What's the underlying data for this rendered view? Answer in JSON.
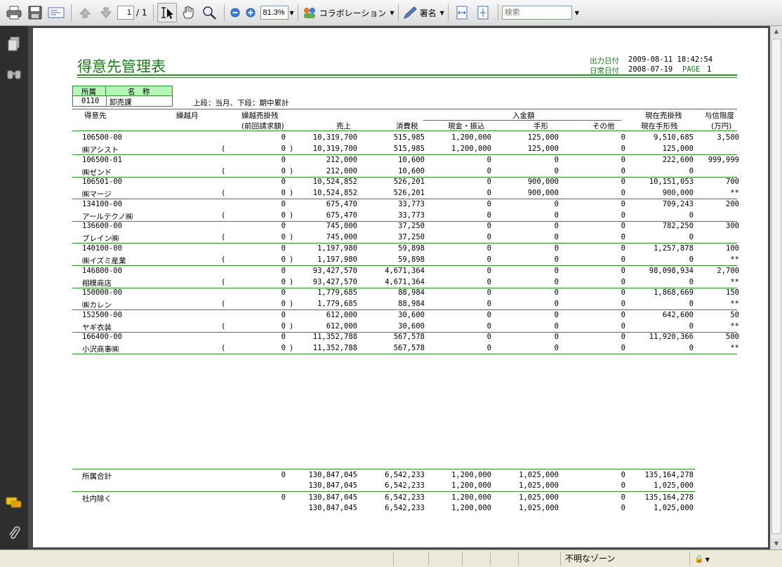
{
  "toolbar": {
    "page_current": "1",
    "page_total": "/ 1",
    "zoom": "81.3%",
    "collab_label": "コラボレーション",
    "sign_label": "署名",
    "search_placeholder": "検索"
  },
  "report": {
    "title": "得意先管理表",
    "output_date_label": "出力日付",
    "output_date": "2009-08-11 18:42:54",
    "daily_date_label": "日常日付",
    "daily_date": "2008-07-19",
    "page_label": "PAGE",
    "page_num": "1",
    "dept_header": "所属",
    "name_header": "名　称",
    "dept_code": "0110",
    "dept_name": "卸売課",
    "legend": "上段：当月、下段：期中累計",
    "headers": {
      "customer": "得意先",
      "carry_month": "繰越月",
      "carry_balance": "繰越売掛残",
      "prev_billing": "(前回請求額)",
      "sales": "売上",
      "tax": "消費税",
      "receipts": "入金額",
      "cash": "現金・振込",
      "bill": "手形",
      "other": "その他",
      "current_balance": "現在売掛残",
      "current_bill": "現在手形残",
      "credit_limit": "与信限度",
      "credit_unit": "(万円)"
    },
    "rows": [
      {
        "code": "106500-00",
        "name": "㈱アシスト",
        "carry1": "0",
        "carry2": "0",
        "sales1": "10,319,700",
        "sales2": "10,319,700",
        "tax1": "515,985",
        "tax2": "515,985",
        "cash1": "1,200,000",
        "cash2": "1,200,000",
        "bill1": "125,000",
        "bill2": "125,000",
        "other1": "0",
        "other2": "0",
        "bal1": "9,510,685",
        "bal2": "125,000",
        "limit1": "3,500",
        "limit2": ""
      },
      {
        "code": "106500-01",
        "name": "㈱ゼンド",
        "carry1": "0",
        "carry2": "0",
        "sales1": "212,000",
        "sales2": "212,000",
        "tax1": "10,600",
        "tax2": "10,600",
        "cash1": "0",
        "cash2": "0",
        "bill1": "0",
        "bill2": "0",
        "other1": "0",
        "other2": "0",
        "bal1": "222,600",
        "bal2": "0",
        "limit1": "999,999",
        "limit2": ""
      },
      {
        "code": "106501-00",
        "name": "㈱マージ",
        "carry1": "0",
        "carry2": "0",
        "sales1": "10,524,852",
        "sales2": "10,524,852",
        "tax1": "526,201",
        "tax2": "526,201",
        "cash1": "0",
        "cash2": "0",
        "bill1": "900,000",
        "bill2": "900,000",
        "other1": "0",
        "other2": "0",
        "bal1": "10,151,053",
        "bal2": "900,000",
        "limit1": "700",
        "limit2": "**"
      },
      {
        "code": "134100-00",
        "name": "アールテクノ㈱",
        "carry1": "0",
        "carry2": "0",
        "sales1": "675,470",
        "sales2": "675,470",
        "tax1": "33,773",
        "tax2": "33,773",
        "cash1": "0",
        "cash2": "0",
        "bill1": "0",
        "bill2": "0",
        "other1": "0",
        "other2": "0",
        "bal1": "709,243",
        "bal2": "0",
        "limit1": "200",
        "limit2": ""
      },
      {
        "code": "136600-00",
        "name": "ブレイン㈱",
        "carry1": "0",
        "carry2": "0",
        "sales1": "745,000",
        "sales2": "745,000",
        "tax1": "37,250",
        "tax2": "37,250",
        "cash1": "0",
        "cash2": "0",
        "bill1": "0",
        "bill2": "0",
        "other1": "0",
        "other2": "0",
        "bal1": "782,250",
        "bal2": "0",
        "limit1": "300",
        "limit2": ""
      },
      {
        "code": "140100-00",
        "name": "㈱イズミ産業",
        "carry1": "0",
        "carry2": "0",
        "sales1": "1,197,980",
        "sales2": "1,197,980",
        "tax1": "59,898",
        "tax2": "59,898",
        "cash1": "0",
        "cash2": "0",
        "bill1": "0",
        "bill2": "0",
        "other1": "0",
        "other2": "0",
        "bal1": "1,257,878",
        "bal2": "0",
        "limit1": "100",
        "limit2": "**"
      },
      {
        "code": "146800-00",
        "name": "相模商店",
        "carry1": "0",
        "carry2": "0",
        "sales1": "93,427,570",
        "sales2": "93,427,570",
        "tax1": "4,671,364",
        "tax2": "4,671,364",
        "cash1": "0",
        "cash2": "0",
        "bill1": "0",
        "bill2": "0",
        "other1": "0",
        "other2": "0",
        "bal1": "98,098,934",
        "bal2": "0",
        "limit1": "2,700",
        "limit2": "**"
      },
      {
        "code": "150000-00",
        "name": "㈱カレン",
        "carry1": "0",
        "carry2": "0",
        "sales1": "1,779,685",
        "sales2": "1,779,685",
        "tax1": "88,984",
        "tax2": "88,984",
        "cash1": "0",
        "cash2": "0",
        "bill1": "0",
        "bill2": "0",
        "other1": "0",
        "other2": "0",
        "bal1": "1,868,669",
        "bal2": "0",
        "limit1": "150",
        "limit2": "**"
      },
      {
        "code": "152500-00",
        "name": "ヤギ衣装",
        "carry1": "0",
        "carry2": "0",
        "sales1": "612,000",
        "sales2": "612,000",
        "tax1": "30,600",
        "tax2": "30,600",
        "cash1": "0",
        "cash2": "0",
        "bill1": "0",
        "bill2": "0",
        "other1": "0",
        "other2": "0",
        "bal1": "642,600",
        "bal2": "0",
        "limit1": "50",
        "limit2": "**"
      },
      {
        "code": "166400-00",
        "name": "小沢商事㈱",
        "carry1": "0",
        "carry2": "0",
        "sales1": "11,352,788",
        "sales2": "11,352,788",
        "tax1": "567,578",
        "tax2": "567,578",
        "cash1": "0",
        "cash2": "0",
        "bill1": "0",
        "bill2": "0",
        "other1": "0",
        "other2": "0",
        "bal1": "11,920,366",
        "bal2": "0",
        "limit1": "500",
        "limit2": "**"
      }
    ],
    "totals": [
      {
        "label": "所属合計",
        "carry": "0",
        "sales1": "130,847,045",
        "sales2": "130,847,045",
        "tax1": "6,542,233",
        "tax2": "6,542,233",
        "cash1": "1,200,000",
        "cash2": "1,200,000",
        "bill1": "1,025,000",
        "bill2": "1,025,000",
        "other1": "0",
        "other2": "0",
        "bal1": "135,164,278",
        "bal2": "1,025,000"
      },
      {
        "label": "社内除く",
        "carry": "0",
        "sales1": "130,847,045",
        "sales2": "130,847,045",
        "tax1": "6,542,233",
        "tax2": "6,542,233",
        "cash1": "1,200,000",
        "cash2": "1,200,000",
        "bill1": "1,025,000",
        "bill2": "1,025,000",
        "other1": "0",
        "other2": "0",
        "bal1": "135,164,278",
        "bal2": "1,025,000"
      }
    ]
  },
  "statusbar": {
    "zone": "不明なゾーン"
  }
}
